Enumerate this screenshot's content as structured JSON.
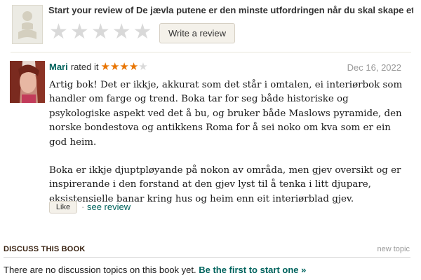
{
  "write_review": {
    "prompt": "Start your review of De jævla putene er den minste utfordringen når du skal skape et ...",
    "button_label": "Write a review",
    "star_rating": 0,
    "star_max": 5
  },
  "review": {
    "reviewer": "Mari",
    "rated_text": "rated it",
    "rating": 4,
    "rating_max": 5,
    "date": "Dec 16, 2022",
    "paragraphs": [
      "Artig bok! Det er ikkje, akkurat som det står i omtalen, ei interiørbok som handler om farge og trend. Boka tar for seg både historiske og psykologiske aspekt ved det å bu, og bruker både Maslows pyramide, den norske bondestova og antikkens Roma for å sei noko om kva som er ein god heim.",
      "Boka er ikkje djuptpløyande på nokon av områda, men gjev oversikt og er inspirerande i den forstand at den gjev lyst til å tenka i litt djupare, eksistensielle banar kring hus og heim enn eit interiørblad gjev."
    ],
    "like_label": "Like",
    "separator": "·",
    "see_review_label": "see review"
  },
  "discussion": {
    "title": "DISCUSS THIS BOOK",
    "new_topic_label": "new topic",
    "empty_text": "There are no discussion topics on this book yet.",
    "first_link_label": "Be the first to start one »"
  },
  "colors": {
    "link": "#00635d",
    "star_on": "#e87400",
    "star_off": "#d9d9d9",
    "button_bg": "#f4f1ea"
  }
}
